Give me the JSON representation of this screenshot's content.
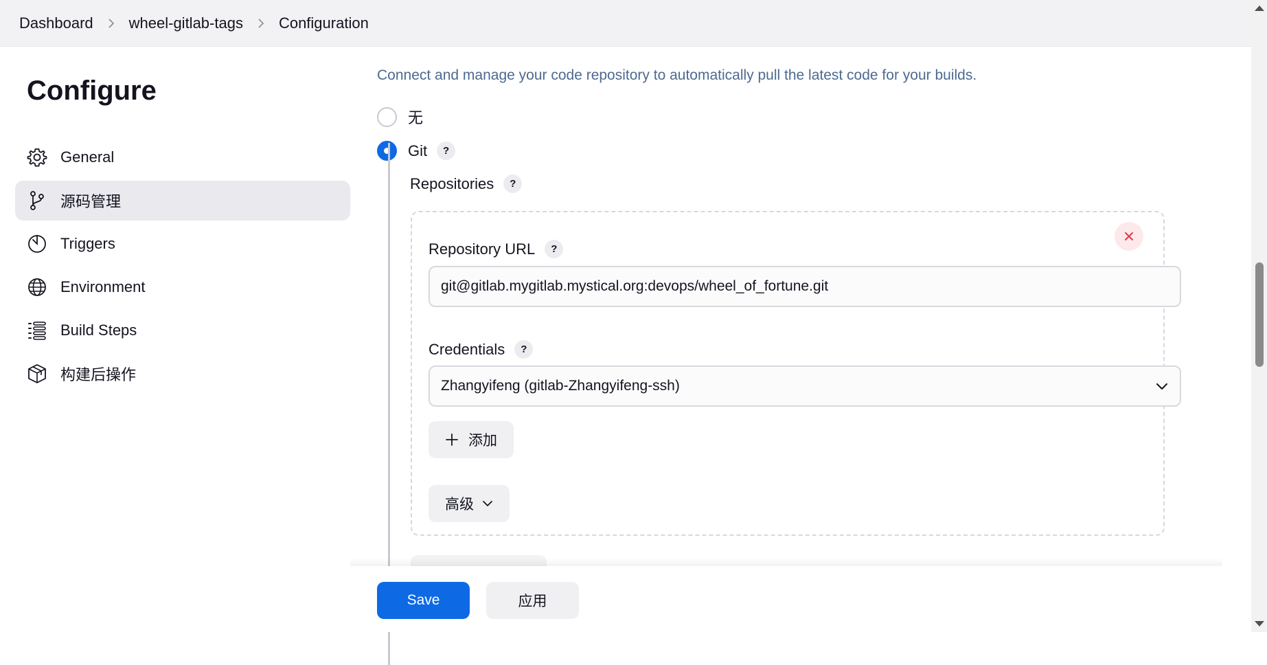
{
  "breadcrumb": {
    "items": [
      "Dashboard",
      "wheel-gitlab-tags",
      "Configuration"
    ]
  },
  "sidebar": {
    "title": "Configure",
    "items": [
      {
        "label": "General",
        "icon": "gear-icon",
        "active": false
      },
      {
        "label": "源码管理",
        "icon": "git-branch-icon",
        "active": true
      },
      {
        "label": "Triggers",
        "icon": "timer-icon",
        "active": false
      },
      {
        "label": "Environment",
        "icon": "globe-icon",
        "active": false
      },
      {
        "label": "Build Steps",
        "icon": "list-steps-icon",
        "active": false
      },
      {
        "label": "构建后操作",
        "icon": "package-icon",
        "active": false
      }
    ]
  },
  "scm": {
    "description": "Connect and manage your code repository to automatically pull the latest code for your builds.",
    "options": [
      {
        "label": "无",
        "selected": false
      },
      {
        "label": "Git",
        "selected": true
      }
    ],
    "help_symbol": "?",
    "repositories_label": "Repositories",
    "repository": {
      "url_label": "Repository URL",
      "url_value": "git@gitlab.mygitlab.mystical.org:devops/wheel_of_fortune.git",
      "credentials_label": "Credentials",
      "credentials_value": "Zhangyifeng (gitlab-Zhangyifeng-ssh)",
      "add_label": "添加",
      "advanced_label": "高级"
    }
  },
  "footer": {
    "save_label": "Save",
    "apply_label": "应用"
  },
  "colors": {
    "accent": "#0d6ae4",
    "description_text": "#4c6a90",
    "danger": "#e6354b"
  }
}
